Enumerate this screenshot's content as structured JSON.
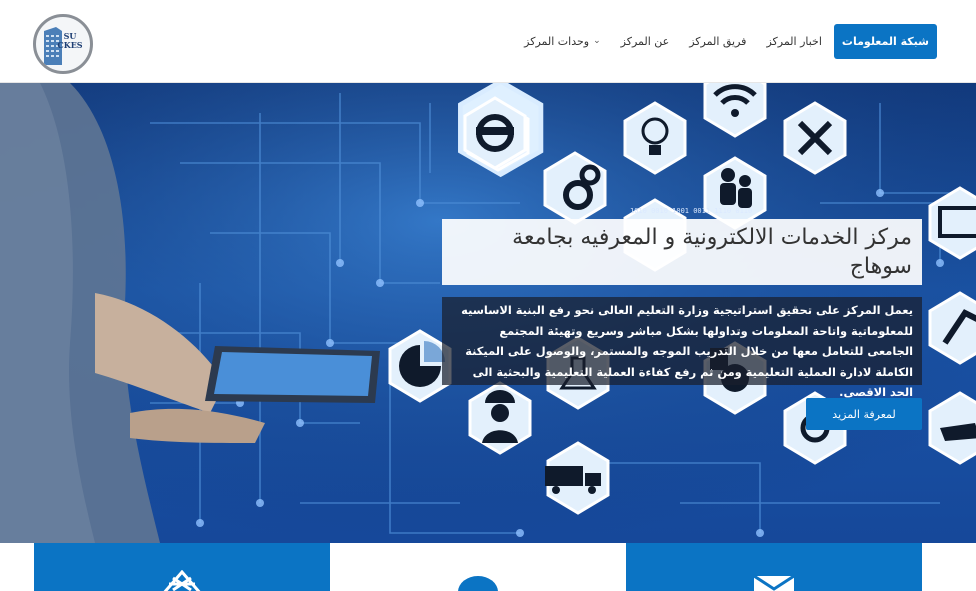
{
  "header": {
    "logo_text": "SU CKES",
    "nav": [
      {
        "label": "شبكة المعلومات",
        "active": true
      },
      {
        "label": "اخبار المركز",
        "active": false
      },
      {
        "label": "فريق المركز",
        "active": false
      },
      {
        "label": "عن المركز",
        "active": false
      },
      {
        "label": "وحدات المركز",
        "active": false,
        "dropdown": true
      }
    ]
  },
  "hero": {
    "title": "مركز الخدمات الالكترونية و المعرفيه بجامعة سوهاج",
    "description": "يعمل المركز على تحقيق استراتيجية وزارة التعليم العالى نحو رفع البنية الاساسيه للمعلوماتية واتاحة المعلومات وتداولها بشكل مباشر وسريع وتهيئة المجتمع الجامعى للتعامل معها من خلال التدريب الموجه والمستمر، والوصول على الميكنة الكاملة لادارة العملية التعليمية ومن ثم رفع كفاءة العملية التعليمية والبحثية الى الحد الاقصى.",
    "more_button": "لمعرفة المزيد",
    "binary_text": "1010 0010 1001 0011 1110 0110"
  },
  "cards": [
    {
      "icon": "network-tower-icon",
      "style": "blue"
    },
    {
      "icon": "user-icon",
      "style": "white"
    },
    {
      "icon": "envelope-icon",
      "style": "blue"
    }
  ],
  "colors": {
    "accent": "#0b74c4",
    "hero_bg": "#1a55a8"
  }
}
